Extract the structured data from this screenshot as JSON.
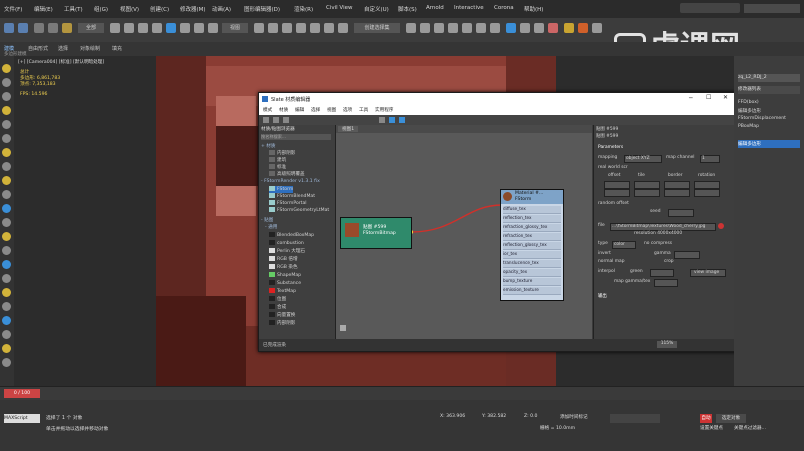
{
  "menubar": {
    "items": [
      "文件(F)",
      "编辑(E)",
      "工具(T)",
      "组(G)",
      "视图(V)",
      "创建(C)",
      "修改器(M)",
      "动画(A)",
      "图形编辑器(D)",
      "渲染(R)",
      "Civil View",
      "自定义(U)",
      "脚本(S)",
      "Arnold",
      "Interactive",
      "Corona",
      "帮助(H)"
    ]
  },
  "toolbar": {
    "selection_set": "创建选择集",
    "view_mode": "视图"
  },
  "ribbon": {
    "items": [
      "建模",
      "自由形式",
      "选择",
      "对象绘制",
      "填充"
    ],
    "sub": "多边形建模"
  },
  "viewport": {
    "label": "[+] [Camera004] [标准] [默认明暗处理]",
    "stats": {
      "total_label": "总计",
      "polys_label": "多边形:",
      "polys": "6,861,783",
      "verts_label": "顶点:",
      "verts": "7,353,183",
      "fps_label": "FPS:",
      "fps": "14.596"
    }
  },
  "slate": {
    "title": "Slate 材质编辑器",
    "menu": [
      "模式",
      "材质",
      "编辑",
      "选择",
      "视图",
      "选项",
      "工具",
      "实用程序"
    ],
    "browser": {
      "header": "材质/贴图浏览器",
      "search_placeholder": "按名称搜索...",
      "group1": "+ 材质",
      "items1": [
        "内部阴影",
        "建筑",
        "标准",
        "高级照明覆盖"
      ],
      "group2": "- FStormRender v1.3.1 fix",
      "items2": [
        "FStorm",
        "FStormBlendMat",
        "FStormPortal",
        "FStormGeometryLtMat"
      ],
      "group3": "- 贴图",
      "group4": "- 通用",
      "items3": [
        "BlendedBoxMap",
        "combustion",
        "Perlin 大理石",
        "RGB 倍增",
        "RGB 染色",
        "ShapeMap",
        "Substance",
        "TextMap",
        "位图",
        "合成",
        "向量置换",
        "内部阴影"
      ]
    },
    "view_tab": "视图1",
    "node_bitmap": {
      "title": "贴图 #599",
      "subtitle": "FStormBitmap"
    },
    "node_material": {
      "title": "Material #...",
      "subtitle": "FStorm",
      "slots": [
        "diffuse_tex",
        "reflection_tex",
        "refraction_glossy_tex",
        "refraction_tex",
        "reflection_glossy_tex",
        "ior_tex",
        "translucence_tex",
        "opacity_tex",
        "bump_texture",
        "emission_texture"
      ]
    },
    "props": {
      "header": "贴图 #599",
      "subheader": "贴图 #599",
      "section": "Parameters",
      "mapping_label": "mapping",
      "mapping_value": "object XYZ",
      "map_channel_label": "map channel",
      "map_channel_value": "1",
      "real_world_label": "real world scr",
      "cols": [
        "offset",
        "tile",
        "border",
        "rotation"
      ],
      "random_offset_label": "random offset",
      "seed_label": "seed",
      "file_label": "file",
      "file_value": "...\\fStormBitmap\\Textures\\Wood_cherry.jpg",
      "resolution": "resolution 4000x4000",
      "type_label": "type",
      "type_value": "color",
      "no_compress": "no compress",
      "invert_label": "invert",
      "gamma_label": "gamma",
      "normal_map_label": "normal map",
      "crop_label": "crop",
      "interp_label": "interpol",
      "green_label": "green",
      "view_image": "view image",
      "map_gamma_label": "map gamma/tex",
      "section2": "输出"
    },
    "zoom": "115%",
    "status": "已完成渲染"
  },
  "rightpanel": {
    "name_field": "zq_L2_RDJ_2",
    "modifier_list": "修改器列表",
    "modifiers": [
      "FFD(box)",
      "编辑多边形",
      "FStormDisplacement",
      "PBoxMap"
    ],
    "selected": "编辑多边形"
  },
  "timeline": {
    "frame": "0 / 100"
  },
  "status": {
    "selected": "选择了 1 个 对象",
    "hint": "单击并拖动以选择并移动对象",
    "maxscript": "MAXScript",
    "x_label": "X:",
    "x": "363.906",
    "y_label": "Y:",
    "y": "382.582",
    "z_label": "Z:",
    "z": "0.0",
    "grid": "栅格 = 10.0mm",
    "add_tag": "添加时间标记",
    "auto": "自动",
    "selected_obj": "选定对象",
    "set_key": "设置关键点",
    "key_filter": "关键点过滤器..."
  },
  "watermark": {
    "text": "虎课网"
  },
  "colors": {
    "accent": "#2e6fbf",
    "node_green": "#2f8a6b",
    "scene_red": "#8a3c33",
    "link_red": "#d0302a"
  }
}
